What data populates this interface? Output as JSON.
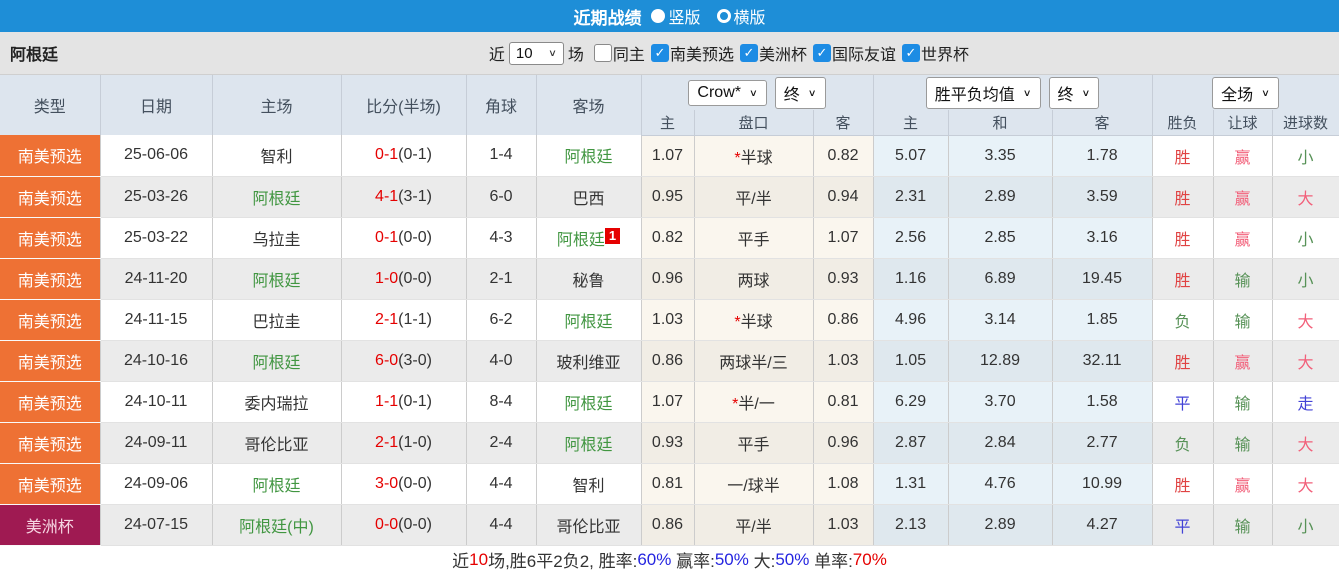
{
  "colors": {
    "topbar_blue": "#1e8ed7",
    "checkbox_blue": "#1d8ce4",
    "type_orange": "#ee7134",
    "type_maroon": "#9f1a52",
    "team_green": "#419641",
    "score_red": "#e50000",
    "win_red": "#e04343",
    "draw_blue": "#4343d6",
    "lose_green": "#579257",
    "pink_red": "#f2607a"
  },
  "topbar": {
    "title": "近期战绩",
    "options": [
      {
        "label": "竖版",
        "selected": true
      },
      {
        "label": "横版",
        "selected": false
      }
    ]
  },
  "filterbar": {
    "team": "阿根廷",
    "near_label": "近",
    "matches_value": "10",
    "matches_label": "场",
    "filters": [
      {
        "label": "同主",
        "checked": false
      },
      {
        "label": "南美预选",
        "checked": true
      },
      {
        "label": "美洲杯",
        "checked": true
      },
      {
        "label": "国际友谊",
        "checked": true
      },
      {
        "label": "世界杯",
        "checked": true
      }
    ]
  },
  "table": {
    "headers_left": [
      "类型",
      "日期",
      "主场",
      "比分(半场)",
      "角球",
      "客场"
    ],
    "selects": {
      "odds_company": "Crow*",
      "odds_time": "终",
      "mean_label": "胜平负均值",
      "mean_time": "终",
      "scope": "全场"
    },
    "subheaders": [
      "主",
      "盘口",
      "客",
      "主",
      "和",
      "客",
      "胜负",
      "让球",
      "进球数"
    ],
    "rows": [
      {
        "type": "南美预选",
        "type_class": "orange",
        "date": "25-06-06",
        "home": "智利",
        "home_team": false,
        "score": "0-1",
        "half": "(0-1)",
        "corners": "1-4",
        "away": "阿根廷",
        "away_team": true,
        "away_badge": "",
        "odds_home": "1.07",
        "handicap_star": true,
        "handicap": "半球",
        "odds_away": "0.82",
        "mean_home": "5.07",
        "mean_draw": "3.35",
        "mean_away": "1.78",
        "result": "胜",
        "result_class": "red",
        "handicap_result": "赢",
        "handicap_result_class": "pink",
        "goals": "小",
        "goals_class": "green"
      },
      {
        "type": "南美预选",
        "type_class": "orange",
        "date": "25-03-26",
        "home": "阿根廷",
        "home_team": true,
        "score": "4-1",
        "half": "(3-1)",
        "corners": "6-0",
        "away": "巴西",
        "away_team": false,
        "away_badge": "",
        "odds_home": "0.95",
        "handicap_star": false,
        "handicap": "平/半",
        "odds_away": "0.94",
        "mean_home": "2.31",
        "mean_draw": "2.89",
        "mean_away": "3.59",
        "result": "胜",
        "result_class": "red",
        "handicap_result": "赢",
        "handicap_result_class": "pink",
        "goals": "大",
        "goals_class": "pink"
      },
      {
        "type": "南美预选",
        "type_class": "orange",
        "date": "25-03-22",
        "home": "乌拉圭",
        "home_team": false,
        "score": "0-1",
        "half": "(0-0)",
        "corners": "4-3",
        "away": "阿根廷",
        "away_team": true,
        "away_badge": "1",
        "odds_home": "0.82",
        "handicap_star": false,
        "handicap": "平手",
        "odds_away": "1.07",
        "mean_home": "2.56",
        "mean_draw": "2.85",
        "mean_away": "3.16",
        "result": "胜",
        "result_class": "red",
        "handicap_result": "赢",
        "handicap_result_class": "pink",
        "goals": "小",
        "goals_class": "green"
      },
      {
        "type": "南美预选",
        "type_class": "orange",
        "date": "24-11-20",
        "home": "阿根廷",
        "home_team": true,
        "score": "1-0",
        "half": "(0-0)",
        "corners": "2-1",
        "away": "秘鲁",
        "away_team": false,
        "away_badge": "",
        "odds_home": "0.96",
        "handicap_star": false,
        "handicap": "两球",
        "odds_away": "0.93",
        "mean_home": "1.16",
        "mean_draw": "6.89",
        "mean_away": "19.45",
        "result": "胜",
        "result_class": "red",
        "handicap_result": "输",
        "handicap_result_class": "green",
        "goals": "小",
        "goals_class": "green"
      },
      {
        "type": "南美预选",
        "type_class": "orange",
        "date": "24-11-15",
        "home": "巴拉圭",
        "home_team": false,
        "score": "2-1",
        "half": "(1-1)",
        "corners": "6-2",
        "away": "阿根廷",
        "away_team": true,
        "away_badge": "",
        "odds_home": "1.03",
        "handicap_star": true,
        "handicap": "半球",
        "odds_away": "0.86",
        "mean_home": "4.96",
        "mean_draw": "3.14",
        "mean_away": "1.85",
        "result": "负",
        "result_class": "green",
        "handicap_result": "输",
        "handicap_result_class": "green",
        "goals": "大",
        "goals_class": "pink"
      },
      {
        "type": "南美预选",
        "type_class": "orange",
        "date": "24-10-16",
        "home": "阿根廷",
        "home_team": true,
        "score": "6-0",
        "half": "(3-0)",
        "corners": "4-0",
        "away": "玻利维亚",
        "away_team": false,
        "away_badge": "",
        "odds_home": "0.86",
        "handicap_star": false,
        "handicap": "两球半/三",
        "odds_away": "1.03",
        "mean_home": "1.05",
        "mean_draw": "12.89",
        "mean_away": "32.11",
        "result": "胜",
        "result_class": "red",
        "handicap_result": "赢",
        "handicap_result_class": "pink",
        "goals": "大",
        "goals_class": "pink"
      },
      {
        "type": "南美预选",
        "type_class": "orange",
        "date": "24-10-11",
        "home": "委内瑞拉",
        "home_team": false,
        "score": "1-1",
        "half": "(0-1)",
        "corners": "8-4",
        "away": "阿根廷",
        "away_team": true,
        "away_badge": "",
        "odds_home": "1.07",
        "handicap_star": true,
        "handicap": "半/一",
        "odds_away": "0.81",
        "mean_home": "6.29",
        "mean_draw": "3.70",
        "mean_away": "1.58",
        "result": "平",
        "result_class": "blue",
        "handicap_result": "输",
        "handicap_result_class": "green",
        "goals": "走",
        "goals_class": "blue"
      },
      {
        "type": "南美预选",
        "type_class": "orange",
        "date": "24-09-11",
        "home": "哥伦比亚",
        "home_team": false,
        "score": "2-1",
        "half": "(1-0)",
        "corners": "2-4",
        "away": "阿根廷",
        "away_team": true,
        "away_badge": "",
        "odds_home": "0.93",
        "handicap_star": false,
        "handicap": "平手",
        "odds_away": "0.96",
        "mean_home": "2.87",
        "mean_draw": "2.84",
        "mean_away": "2.77",
        "result": "负",
        "result_class": "green",
        "handicap_result": "输",
        "handicap_result_class": "green",
        "goals": "大",
        "goals_class": "pink"
      },
      {
        "type": "南美预选",
        "type_class": "orange",
        "date": "24-09-06",
        "home": "阿根廷",
        "home_team": true,
        "score": "3-0",
        "half": "(0-0)",
        "corners": "4-4",
        "away": "智利",
        "away_team": false,
        "away_badge": "",
        "odds_home": "0.81",
        "handicap_star": false,
        "handicap": "一/球半",
        "odds_away": "1.08",
        "mean_home": "1.31",
        "mean_draw": "4.76",
        "mean_away": "10.99",
        "result": "胜",
        "result_class": "red",
        "handicap_result": "赢",
        "handicap_result_class": "pink",
        "goals": "大",
        "goals_class": "pink"
      },
      {
        "type": "美洲杯",
        "type_class": "maroon",
        "date": "24-07-15",
        "home": "阿根廷(中)",
        "home_team": true,
        "score": "0-0",
        "half": "(0-0)",
        "corners": "4-4",
        "away": "哥伦比亚",
        "away_team": false,
        "away_badge": "",
        "odds_home": "0.86",
        "handicap_star": false,
        "handicap": "平/半",
        "odds_away": "1.03",
        "mean_home": "2.13",
        "mean_draw": "2.89",
        "mean_away": "4.27",
        "result": "平",
        "result_class": "blue",
        "handicap_result": "输",
        "handicap_result_class": "green",
        "goals": "小",
        "goals_class": "green"
      }
    ]
  },
  "footer": {
    "segments": [
      {
        "text": "近",
        "class": "dark"
      },
      {
        "text": "10",
        "class": "red"
      },
      {
        "text": "场,胜6平2负2, 胜率:",
        "class": "dark"
      },
      {
        "text": "60%",
        "class": "blue"
      },
      {
        "text": " 赢率:",
        "class": "dark"
      },
      {
        "text": "50%",
        "class": "blue"
      },
      {
        "text": " 大:",
        "class": "dark"
      },
      {
        "text": "50%",
        "class": "blue"
      },
      {
        "text": " 单率:",
        "class": "dark"
      },
      {
        "text": "70%",
        "class": "red"
      }
    ]
  }
}
